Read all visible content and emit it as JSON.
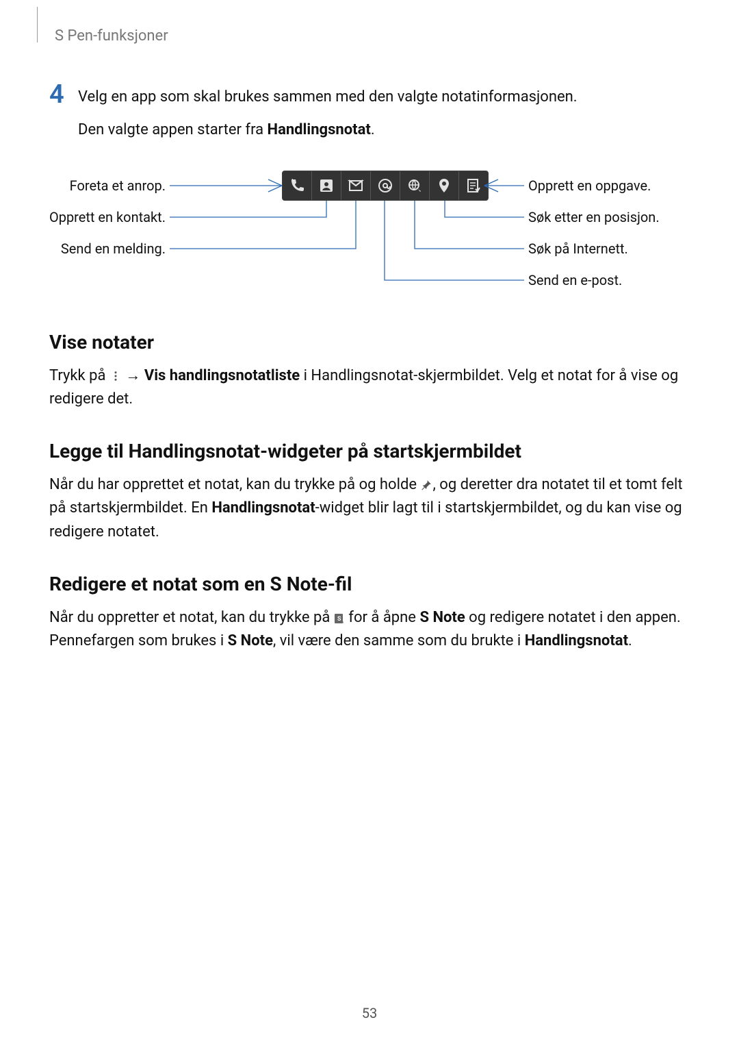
{
  "header": {
    "title": "S Pen-funksjoner"
  },
  "step4": {
    "number": "4",
    "line1": "Velg en app som skal brukes sammen med den valgte notatinformasjonen.",
    "line2a": "Den valgte appen starter fra ",
    "line2b": "Handlingsnotat",
    "line2c": "."
  },
  "figure": {
    "left": {
      "call": "Foreta et anrop.",
      "contact": "Opprett en kontakt.",
      "message": "Send en melding."
    },
    "right": {
      "task": "Opprett en oppgave.",
      "location": "Søk etter en posisjon.",
      "internet": "Søk på Internett.",
      "email": "Send en e-post."
    }
  },
  "sec1": {
    "heading": "Vise notater",
    "p1a": "Trykk på ",
    "p1b": " → ",
    "p1c": "Vis handlingsnotatliste",
    "p1d": " i Handlingsnotat-skjermbildet. Velg et notat for å vise og redigere det."
  },
  "sec2": {
    "heading": "Legge til Handlingsnotat-widgeter på startskjermbildet",
    "p1a": "Når du har opprettet et notat, kan du trykke på og holde ",
    "p1b": ", og deretter dra notatet til et tomt felt på startskjermbildet. En ",
    "p1c": "Handlingsnotat",
    "p1d": "-widget blir lagt til i startskjermbildet, og du kan vise og redigere notatet."
  },
  "sec3": {
    "heading": "Redigere et notat som en S Note-fil",
    "p1a": "Når du oppretter et notat, kan du trykke på ",
    "p1b": " for å åpne ",
    "p1c": "S Note",
    "p1d": " og redigere notatet i den appen. Pennefargen som brukes i ",
    "p1e": "S Note",
    "p1f": ", vil være den samme som du brukte i ",
    "p1g": "Handlingsnotat",
    "p1h": "."
  },
  "pageNumber": "53"
}
